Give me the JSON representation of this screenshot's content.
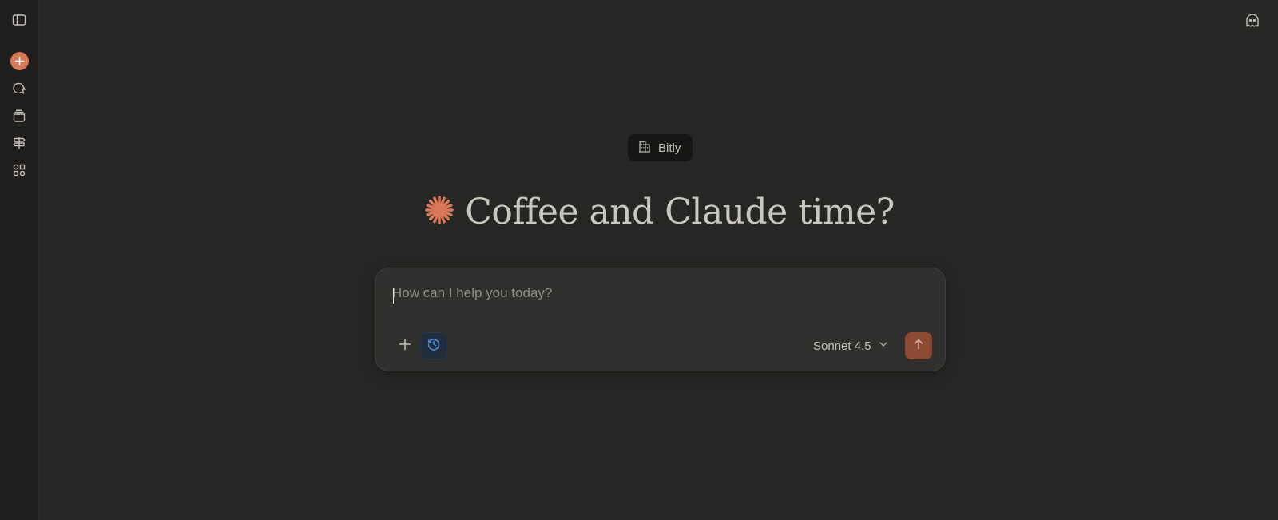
{
  "colors": {
    "background": "#262624",
    "sidebar": "#1f1e1d",
    "accent": "#d97757",
    "send_button": "#8c4a33",
    "research_blue": "#4a8fd9"
  },
  "sidebar": {
    "items": [
      {
        "name": "toggle-sidebar",
        "icon": "sidebar-panel-icon"
      },
      {
        "name": "new-chat",
        "icon": "plus-circle-icon"
      },
      {
        "name": "chats",
        "icon": "chat-bubbles-icon"
      },
      {
        "name": "projects",
        "icon": "archive-stack-icon"
      },
      {
        "name": "settings-signpost",
        "icon": "signpost-icon"
      },
      {
        "name": "artifacts",
        "icon": "shapes-grid-icon"
      }
    ]
  },
  "header": {
    "incognito_icon": "ghost-icon"
  },
  "org": {
    "icon": "building-icon",
    "label": "Bitly"
  },
  "greeting": {
    "icon": "claude-spark-icon",
    "text": "Coffee and Claude time?"
  },
  "composer": {
    "placeholder": "How can I help you today?",
    "value": "",
    "add_icon": "plus-icon",
    "research_icon": "clock-icon",
    "model": "Sonnet 4.5",
    "model_chevron": "chevron-down-icon",
    "send_icon": "arrow-up-icon"
  }
}
